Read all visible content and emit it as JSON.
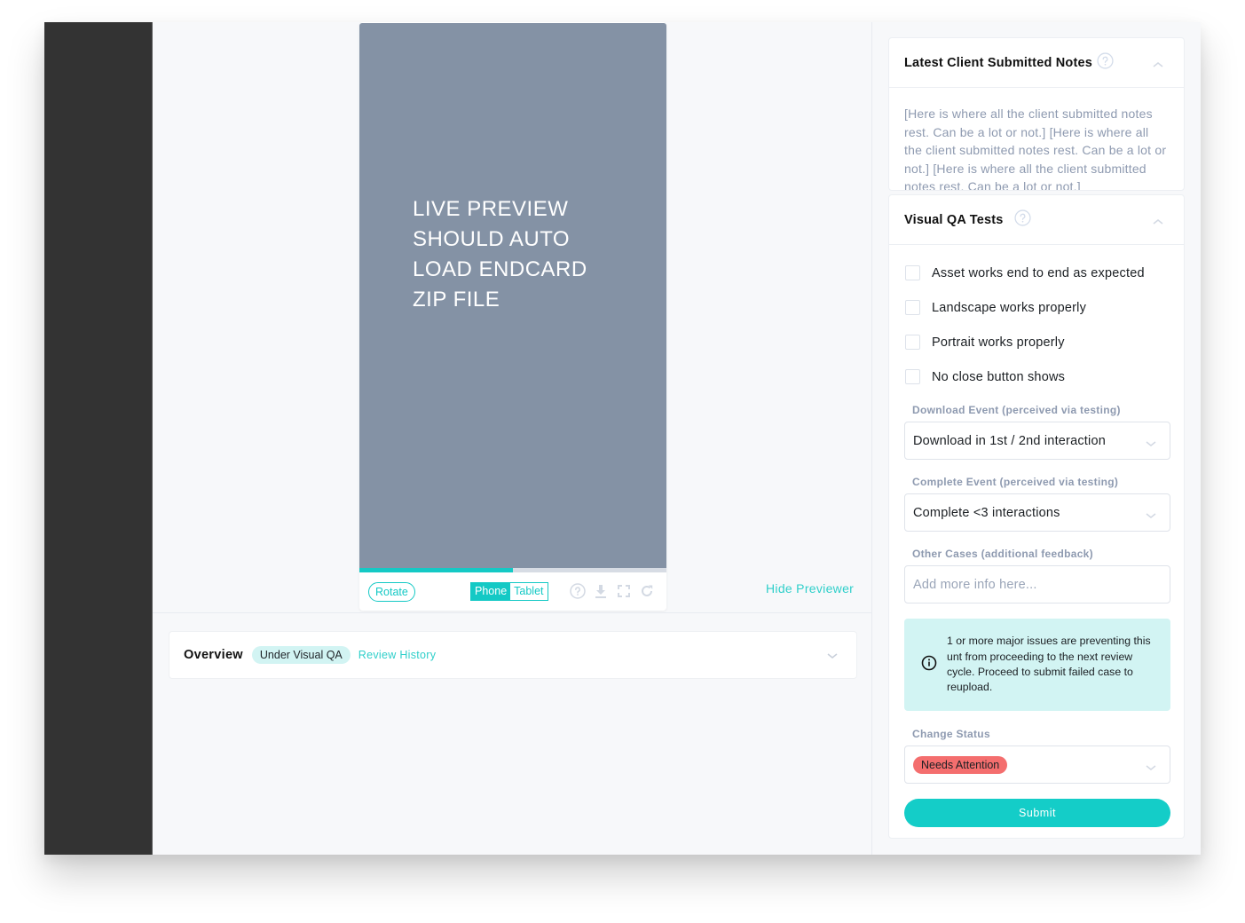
{
  "colors": {
    "accent": "#14c9c5",
    "sidebar": "#333333",
    "preview_bg": "#8492a5",
    "status_pill_bg": "#d2f4f3",
    "needs_attention": "#f46e6e"
  },
  "preview": {
    "placeholder_text": "LIVE PREVIEW SHOULD AUTO LOAD ENDCARD ZIP FILE",
    "progress_percent": 50,
    "toolbar": {
      "rotate_label": "Rotate",
      "device_options": [
        "Phone",
        "Tablet"
      ],
      "selected_device": "Phone",
      "icons": [
        "help-icon",
        "download-icon",
        "fullscreen-icon",
        "refresh-icon"
      ]
    },
    "hide_previewer_label": "Hide Previewer"
  },
  "overview": {
    "title": "Overview",
    "status": "Under Visual QA",
    "review_history_label": "Review History"
  },
  "notes": {
    "title": "Latest Client Submitted Notes",
    "body": "[Here is where all the client submitted notes rest. Can be a lot or not.] [Here is where all the client submitted notes rest. Can be a lot or not.] [Here is where all the client submitted notes rest. Can be a lot or not.]"
  },
  "qa": {
    "title": "Visual QA Tests",
    "checks": [
      {
        "label": "Asset works end to end as expected",
        "checked": false
      },
      {
        "label": "Landscape works properly",
        "checked": false
      },
      {
        "label": "Portrait works properly",
        "checked": false
      },
      {
        "label": "No close button shows",
        "checked": false
      }
    ],
    "download_event": {
      "label": "Download Event (perceived via testing)",
      "value": "Download in 1st / 2nd interaction"
    },
    "complete_event": {
      "label": "Complete Event (perceived via testing)",
      "value": "Complete <3 interactions"
    },
    "other_cases": {
      "label": "Other Cases (additional feedback)",
      "value": "",
      "placeholder": "Add more info here..."
    },
    "alert": "1 or more major issues are preventing this unt from proceeding to the next review cycle. Proceed to submit failed case to reupload.",
    "change_status": {
      "label": "Change Status",
      "value": "Needs Attention"
    },
    "submit_label": "Submit"
  }
}
